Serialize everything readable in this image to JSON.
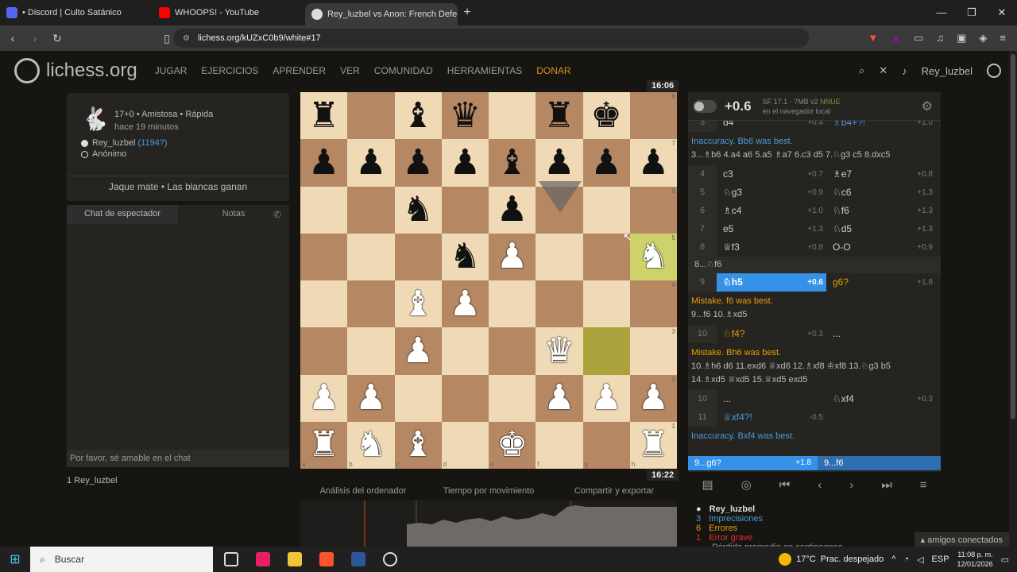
{
  "browser": {
    "tabs": [
      {
        "label": "• Discord | Culto Satánico",
        "color": "#5865f2"
      },
      {
        "label": "WHOOPS! - YouTube",
        "color": "#ff0000"
      },
      {
        "label": "Rey_luzbel vs Anon: French Defe",
        "color": "#dddddd"
      }
    ],
    "url": "lichess.org/kUZxC0b9/white#17"
  },
  "header": {
    "logo": "lichess.org",
    "menu": [
      "JUGAR",
      "EJERCICIOS",
      "APRENDER",
      "VER",
      "COMUNIDAD",
      "HERRAMIENTAS",
      "DONAR"
    ],
    "user": "Rey_luzbel"
  },
  "game": {
    "type": "17+0 • Amistosa • Rápida",
    "time_ago": "hace 19 minutos",
    "white": "Rey_luzbel",
    "white_rating": "(1194?)",
    "black": "Anónimo",
    "result": "Jaque mate • Las blancas ganan"
  },
  "chat": {
    "tab_chat": "Chat de espectador",
    "tab_notes": "Notas",
    "placeholder": "Por favor, sé amable en el chat"
  },
  "spectators": "1  Rey_luzbel",
  "clocks": {
    "top": "16:06",
    "bottom": "16:22"
  },
  "board": [
    [
      "br",
      "",
      "bb",
      "bq",
      "",
      "br",
      "bk",
      ""
    ],
    [
      "bp",
      "bp",
      "bp",
      "bp",
      "bb",
      "bp",
      "bp",
      "bp"
    ],
    [
      "",
      "",
      "bn",
      "",
      "bp",
      "",
      "",
      ""
    ],
    [
      "",
      "",
      "",
      "bn",
      "wp",
      "",
      "",
      "wn"
    ],
    [
      "",
      "",
      "wb",
      "wp",
      "",
      "",
      "",
      ""
    ],
    [
      "",
      "",
      "wp",
      "",
      "",
      "wq",
      "",
      ""
    ],
    [
      "wp",
      "wp",
      "",
      "",
      "",
      "wp",
      "wp",
      "wp"
    ],
    [
      "wr",
      "wn",
      "wb",
      "",
      "wk",
      "",
      "",
      "wr"
    ]
  ],
  "board_tabs": [
    "Análisis del ordenador",
    "Tiempo por movimiento",
    "Compartir y exportar"
  ],
  "engine": {
    "score": "+0.6",
    "name": "SF 17.1 · 7MB v2",
    "nnue": "NNUE",
    "where": "en el navegador local"
  },
  "moves_top": {
    "n": "3",
    "w": "d4",
    "we": "+0.4",
    "b": "♗b4+?!",
    "be": "+1.0"
  },
  "comment1": {
    "label": "Inaccuracy. Bb6 was best.",
    "line": "3...♗b6 4.a4 a6 5.a5 ♗a7 6.c3 d5 7.♘g3 c5 8.dxc5"
  },
  "moves": [
    {
      "n": "4",
      "w": "c3",
      "we": "+0.7",
      "b": "♗e7",
      "be": "+0.8"
    },
    {
      "n": "5",
      "w": "♘g3",
      "we": "+0.9",
      "b": "♘c6",
      "be": "+1.3"
    },
    {
      "n": "6",
      "w": "♗c4",
      "we": "+1.0",
      "b": "♘f6",
      "be": "+1.3"
    },
    {
      "n": "7",
      "w": "e5",
      "we": "+1.3",
      "b": "♘d5",
      "be": "+1.3"
    },
    {
      "n": "8",
      "w": "♕f3",
      "we": "+0.8",
      "b": "O-O",
      "be": "+0.9"
    }
  ],
  "var8": "8...♘f6",
  "move9": {
    "n": "9",
    "w": "♘h5",
    "we": "+0.6",
    "b": "g6?",
    "be": "+1.8"
  },
  "comment2": {
    "label": "Mistake. f6 was best.",
    "line": "9...f6 10.♗xd5"
  },
  "move10a": {
    "n": "10",
    "w": "♘f4?",
    "we": "+0.3",
    "b": "..."
  },
  "comment3": {
    "label": "Mistake. Bh6 was best.",
    "line1": "10.♗h6 d6 11.exd6 ♕xd6 12.♗xf8 ♔xf8 13.♘g3 b5",
    "line2": "14.♗xd5 ♕xd5 15.♕xd5 exd5"
  },
  "move10b": {
    "n": "10",
    "w": "...",
    "b": "♘xf4",
    "be": "+0.3"
  },
  "move11": {
    "n": "11",
    "w": "♕xf4?!",
    "we": "-0.5"
  },
  "comment4": "Inaccuracy. Bxf4 was best.",
  "bottom_bar": {
    "a": "9...g6?",
    "ae": "+1.8",
    "b": "9...f6"
  },
  "stats": {
    "player": "Rey_luzbel",
    "inacc_n": "3",
    "inacc": "Imprecisiones",
    "mist_n": "6",
    "mist": "Errores",
    "blund_n": "1",
    "blund": "Error grave",
    "acpl": "Pérdida promedio en centipeones"
  },
  "friends": "amigos conectados",
  "taskbar": {
    "search": "Buscar",
    "temp": "17°C",
    "weather": "Prac. despejado",
    "lang": "ESP",
    "time": "11:08 p. m.",
    "date": "12/01/2026"
  }
}
